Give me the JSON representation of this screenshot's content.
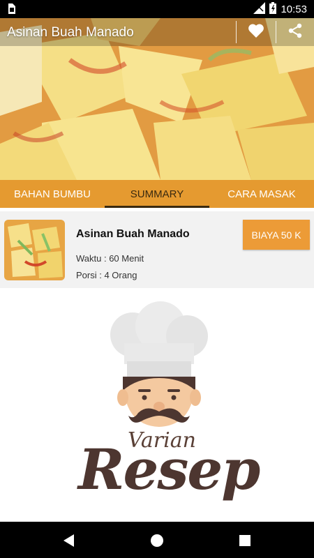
{
  "status_bar": {
    "time": "10:53",
    "icons": [
      "sim-icon",
      "signal-icon",
      "battery-icon"
    ]
  },
  "toolbar": {
    "title": "Asinan Buah Manado",
    "favorite_icon": "heart-icon",
    "share_icon": "share-icon"
  },
  "tabs": [
    {
      "label": "BAHAN BUMBU",
      "active": false
    },
    {
      "label": "SUMMARY",
      "active": true
    },
    {
      "label": "CARA MASAK",
      "active": false
    }
  ],
  "summary": {
    "name": "Asinan Buah Manado",
    "waktu": "Waktu : 60 Menit",
    "porsi": "Porsi : 4 Orang",
    "biaya": "BIAYA 50 K"
  },
  "logo": {
    "line1": "Varian",
    "line2": "Resep"
  },
  "nav_bar": [
    "back-icon",
    "home-icon",
    "recents-icon"
  ],
  "colors": {
    "accent": "#E59A30",
    "button": "#EC9B37",
    "tab_indicator": "#3A2A10",
    "logo_brown": "#4D3630"
  }
}
